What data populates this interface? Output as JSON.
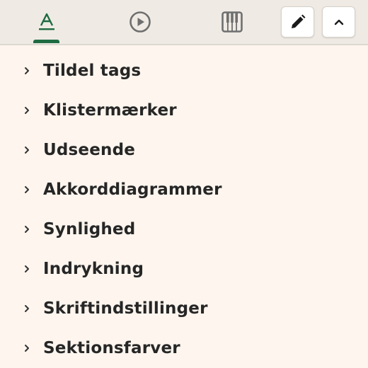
{
  "toolbar": {
    "tabs": [
      {
        "icon": "text-format-icon",
        "active": true
      },
      {
        "icon": "play-circle-icon",
        "active": false
      },
      {
        "icon": "piano-icon",
        "active": false
      }
    ],
    "accent_color": "#1e6b42",
    "edit_icon": "pencil-icon",
    "collapse_icon": "chevron-up-icon"
  },
  "sections": [
    {
      "label": "Tildel tags"
    },
    {
      "label": "Klistermærker"
    },
    {
      "label": "Udseende"
    },
    {
      "label": "Akkorddiagrammer"
    },
    {
      "label": "Synlighed"
    },
    {
      "label": "Indrykning"
    },
    {
      "label": "Skriftindstillinger"
    },
    {
      "label": "Sektionsfarver"
    }
  ]
}
